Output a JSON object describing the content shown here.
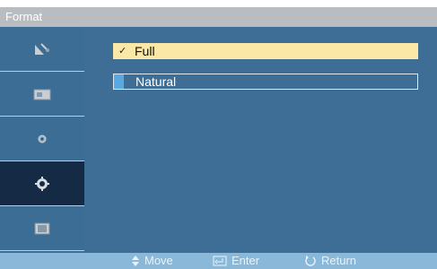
{
  "window": {
    "title": "Format"
  },
  "sidebar": {
    "items": [
      {
        "icon": "satellite-dish-icon",
        "active": false
      },
      {
        "icon": "picture-icon",
        "active": false
      },
      {
        "icon": "sound-icon",
        "active": false
      },
      {
        "icon": "gear-icon",
        "active": true
      },
      {
        "icon": "monitor-icon",
        "active": false
      }
    ]
  },
  "menu": {
    "options": [
      {
        "label": "Full",
        "selected": true,
        "check": "✓"
      },
      {
        "label": "Natural",
        "selected": false
      }
    ]
  },
  "footer": {
    "move_label": "Move",
    "enter_label": "Enter",
    "return_label": "Return"
  },
  "colors": {
    "title_bar": "#b9bcc0",
    "sidebar": "#3b6d95",
    "sidebar_active": "#152a44",
    "content": "#3e6e95",
    "selected_option": "#fbe7a6",
    "footer": "#8ab8d9"
  }
}
